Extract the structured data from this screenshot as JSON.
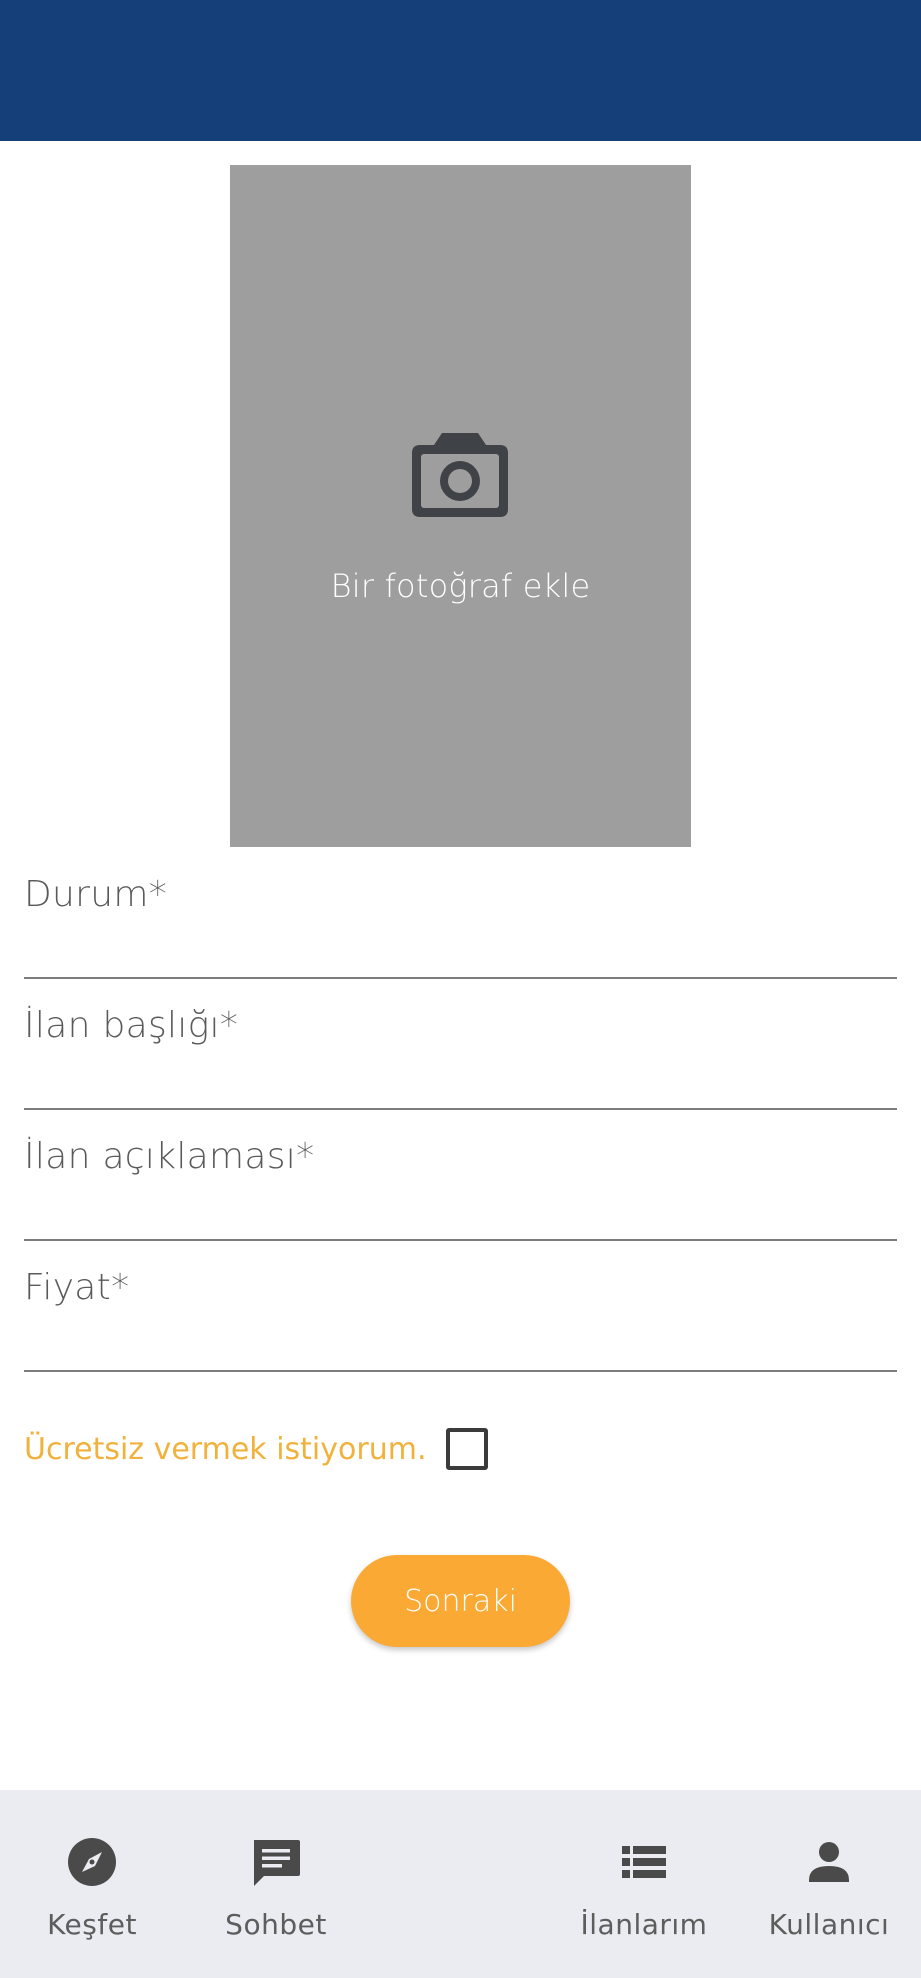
{
  "colors": {
    "app_bar": "#143f78",
    "photo_placeholder": "#9e9e9e",
    "accent": "#fba935",
    "free_label": "#f0b23c",
    "nav_background": "#ebecf1"
  },
  "photo": {
    "icon": "camera-icon",
    "label": "Bir fotoğraf ekle"
  },
  "form": {
    "fields": [
      {
        "label": "Durum*",
        "value": ""
      },
      {
        "label": "İlan başlığı*",
        "value": ""
      },
      {
        "label": "İlan açıklaması*",
        "value": ""
      },
      {
        "label": "Fiyat*",
        "value": ""
      }
    ],
    "free_label": "Ücretsiz vermek istiyorum.",
    "free_checked": false,
    "next_label": "Sonraki"
  },
  "bottom_nav": {
    "items": [
      {
        "icon": "compass-icon",
        "label": "Keşfet"
      },
      {
        "icon": "chat-icon",
        "label": "Sohbet"
      },
      {
        "icon": "list-icon",
        "label": "İlanlarım"
      },
      {
        "icon": "person-icon",
        "label": "Kullanıcı"
      }
    ]
  }
}
